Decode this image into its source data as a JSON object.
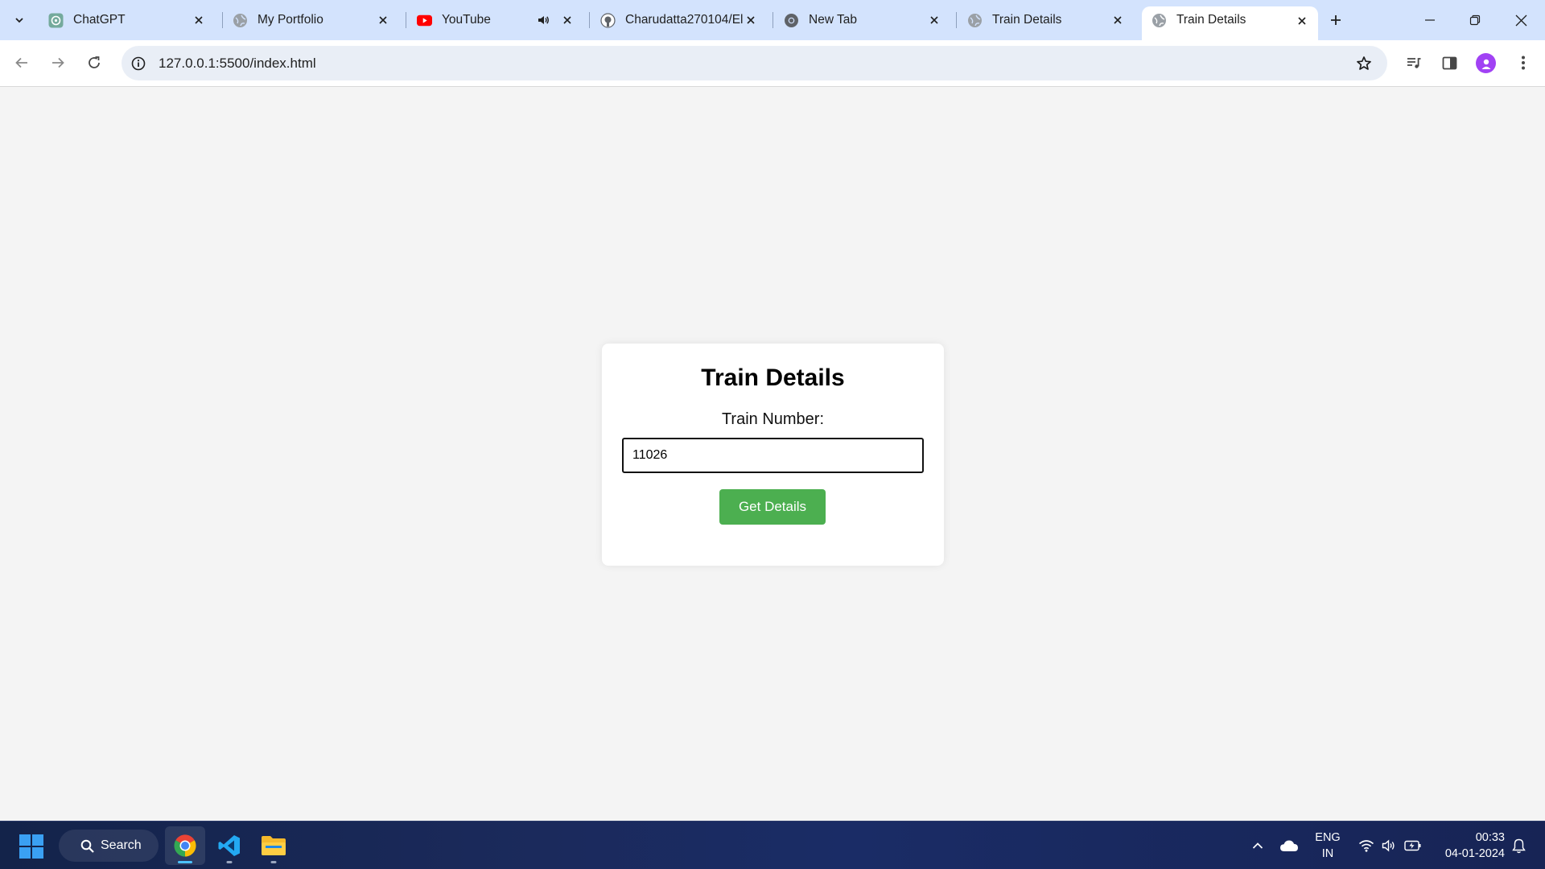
{
  "browser": {
    "tabs": [
      {
        "title": "ChatGPT",
        "favicon": "chatgpt-icon"
      },
      {
        "title": "My Portfolio",
        "favicon": "globe-icon"
      },
      {
        "title": "YouTube",
        "favicon": "youtube-icon",
        "audio": true
      },
      {
        "title": "Charudatta270104/El",
        "favicon": "github-icon"
      },
      {
        "title": "New Tab",
        "favicon": "chrome-icon"
      },
      {
        "title": "Train Details",
        "favicon": "globe-icon"
      },
      {
        "title": "Train Details",
        "favicon": "globe-icon",
        "active": true
      }
    ],
    "url": "127.0.0.1:5500/index.html"
  },
  "page": {
    "heading": "Train Details",
    "train_label": "Train Number:",
    "train_value": "11026",
    "button_label": "Get Details",
    "button_color": "#4caf50"
  },
  "taskbar": {
    "search_label": "Search",
    "lang_top": "ENG",
    "lang_bottom": "IN",
    "time": "00:33",
    "date": "04-01-2024"
  }
}
